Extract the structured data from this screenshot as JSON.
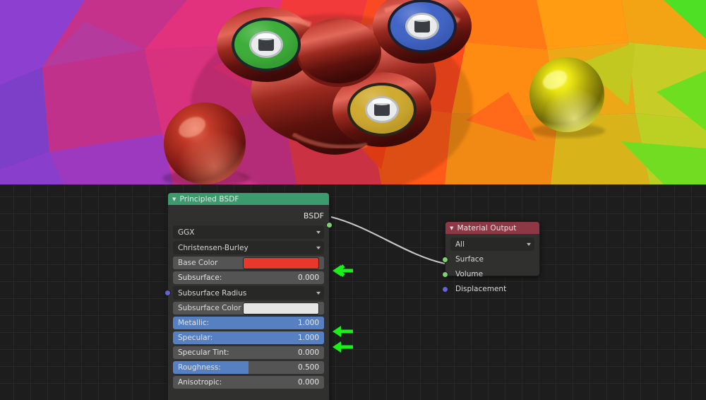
{
  "app": {
    "name": "Blender Shader Editor",
    "viewport_label": "rendered-3d-viewport"
  },
  "viewport": {
    "description": "Rendered 3D viewport showing a metallic red fidget spinner with green, blue and gold bearing caps, a red metallic sphere and a yellow metallic sphere over a low-poly gradient background",
    "background_colors": [
      "#8B3FD1",
      "#E0408A",
      "#F43A2A",
      "#FF6A12",
      "#FFA810",
      "#C8D427",
      "#3BE021"
    ],
    "objects": [
      {
        "name": "fidget-spinner",
        "body_color": "#B02A20",
        "caps": [
          "#3DAF3A",
          "#3E63C8",
          "#D1A92A"
        ]
      },
      {
        "name": "red-metal-sphere",
        "color": "#B0271C"
      },
      {
        "name": "yellow-metal-sphere",
        "color": "#D6D209"
      }
    ]
  },
  "nodes": {
    "principled_bsdf": {
      "title": "Principled BSDF",
      "header_color": "#3c9b6e",
      "collapse_icon": "triangle-down-icon",
      "output_socket": {
        "label": "BSDF",
        "color": "#7ed070"
      },
      "distribution": "GGX",
      "subsurface_method": "Christensen-Burley",
      "inputs": [
        {
          "label": "Base Color",
          "type": "color",
          "value": "#e8382a",
          "socket": "#dfd33a"
        },
        {
          "label": "Subsurface:",
          "type": "slider",
          "value": "0.000",
          "fill": 0,
          "highlight": false,
          "socket": "#a0a0a0"
        },
        {
          "label": "Subsurface Radius",
          "type": "select",
          "value": "",
          "socket": "#6363d8"
        },
        {
          "label": "Subsurface Color",
          "type": "color",
          "value": "#e5e5e5",
          "socket": "#dfd33a"
        },
        {
          "label": "Metallic:",
          "type": "slider",
          "value": "1.000",
          "fill": 100,
          "highlight": true,
          "socket": "#a0a0a0"
        },
        {
          "label": "Specular:",
          "type": "slider",
          "value": "1.000",
          "fill": 100,
          "highlight": true,
          "socket": "#a0a0a0"
        },
        {
          "label": "Specular Tint:",
          "type": "slider",
          "value": "0.000",
          "fill": 0,
          "highlight": false,
          "socket": "#a0a0a0"
        },
        {
          "label": "Roughness:",
          "type": "slider",
          "value": "0.500",
          "fill": 50,
          "highlight": true,
          "socket": "#a0a0a0"
        },
        {
          "label": "Anisotropic:",
          "type": "slider",
          "value": "0.000",
          "fill": 0,
          "highlight": false,
          "socket": "#a0a0a0"
        }
      ]
    },
    "material_output": {
      "title": "Material Output",
      "header_color": "#8e3745",
      "collapse_icon": "triangle-down-icon",
      "target": "All",
      "inputs": [
        {
          "label": "Surface",
          "socket": "#7ed070"
        },
        {
          "label": "Volume",
          "socket": "#7ed070"
        },
        {
          "label": "Displacement",
          "socket": "#6363d8"
        }
      ]
    }
  },
  "link": {
    "from": "BSDF",
    "to": "Surface",
    "color": "#c8c8c8"
  },
  "annotations": {
    "color": "#19F019",
    "arrows": [
      {
        "id": "arrow-base-color",
        "points_at": "Base Color"
      },
      {
        "id": "arrow-metallic",
        "points_at": "Metallic:"
      },
      {
        "id": "arrow-specular",
        "points_at": "Specular:"
      }
    ]
  }
}
